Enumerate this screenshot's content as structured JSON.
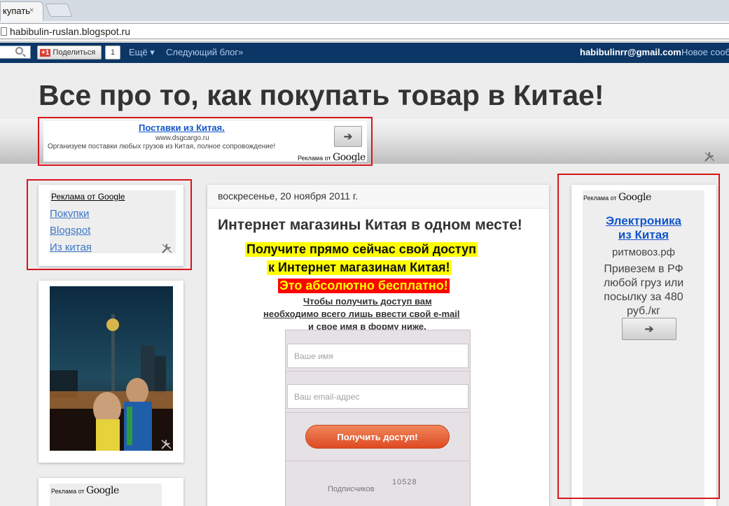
{
  "browser": {
    "tab_title": "купать",
    "tab_close": "×",
    "url": "habibulin-ruslan.blogspot.ru"
  },
  "navbar": {
    "share_badge": "+1",
    "share_label": "Поделиться",
    "share_count": "1",
    "more": "Ещё ▾",
    "next_blog": "Следующий блог»",
    "email": "habibulinrr@gmail.com",
    "new_post": "Новое сообщение"
  },
  "header": {
    "title": "Все про то, как покупать товар в Китае!"
  },
  "top_ad": {
    "title": "Поставки из Китая.",
    "url": "www.dsgcargo.ru",
    "text": "Организуем поставки любых грузов из Китая, полное сопровождение!",
    "ads_by": "Реклама от",
    "google": "Google",
    "arrow": "➔"
  },
  "left_ad": {
    "heading": "Реклама от Google",
    "links": [
      "Покупки",
      "Blogspot",
      "Из китая"
    ]
  },
  "bottom_left_ad": {
    "ads_by": "Реклама от",
    "google": "Google"
  },
  "post": {
    "date": "воскресенье, 20 ноября 2011 г.",
    "title": "Интернет магазины Китая в одном месте!",
    "highlight_line1": "Получите прямо сейчас свой доступ",
    "highlight_line2": "к Интернет магазинам Китая!",
    "red_line": "Это абсолютно бесплатно!",
    "instruction_line1": "Чтобы получить доступ вам",
    "instruction_line2": "необходимо всего лишь ввести свой e-mail",
    "instruction_line3": "и свое имя в форму ниже."
  },
  "form": {
    "name_placeholder": "Ваше имя",
    "email_placeholder": "Ваш email-адрес",
    "submit_label": "Получить доступ!",
    "subscribers_label": "Подписчиков",
    "subscribers_count": "10528"
  },
  "right_ad": {
    "ads_by": "Реклама от",
    "google": "Google",
    "title_line1": "Электроника",
    "title_line2": "из Китая",
    "domain": "ритмовоз.рф",
    "text_line1": "Привезем в РФ",
    "text_line2": "любой груз или",
    "text_line3": "посылку за 480",
    "text_line4": "руб./кг",
    "arrow": "➔"
  },
  "colors": {
    "navbar": "#0c3666",
    "highlight_box": "#d8151c",
    "ad_link": "#1155cc",
    "submit_button": "#e8603a"
  }
}
